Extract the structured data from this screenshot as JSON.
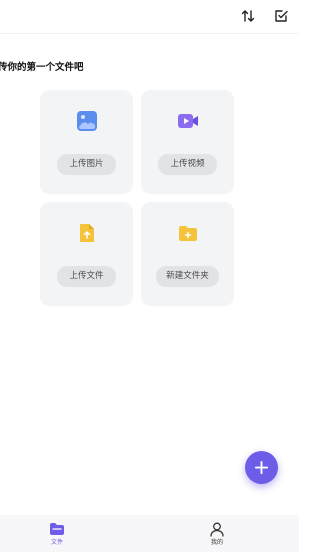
{
  "header": {
    "icons": [
      "sort-icon",
      "edit-check-icon"
    ]
  },
  "hint_text": "传你的第一个文件吧",
  "cards": [
    {
      "label": "上传图片",
      "icon": "image-icon"
    },
    {
      "label": "上传视频",
      "icon": "video-icon"
    },
    {
      "label": "上传文件",
      "icon": "file-upload-icon"
    },
    {
      "label": "新建文件夹",
      "icon": "folder-icon"
    }
  ],
  "fab": {
    "icon": "plus-icon"
  },
  "tabbar": {
    "tabs": [
      {
        "label": "文件",
        "icon": "folder-tab-icon",
        "active": true
      },
      {
        "label": "我的",
        "icon": "person-icon",
        "active": false
      }
    ]
  },
  "colors": {
    "accent": "#6c5ce7",
    "card_bg": "#f3f4f6",
    "label_pill": "#e2e3e6",
    "image_icon": "#5b8def",
    "video_icon": "#8b6cf0",
    "file_icon": "#f5c33b",
    "folder_icon": "#f5c33b"
  }
}
